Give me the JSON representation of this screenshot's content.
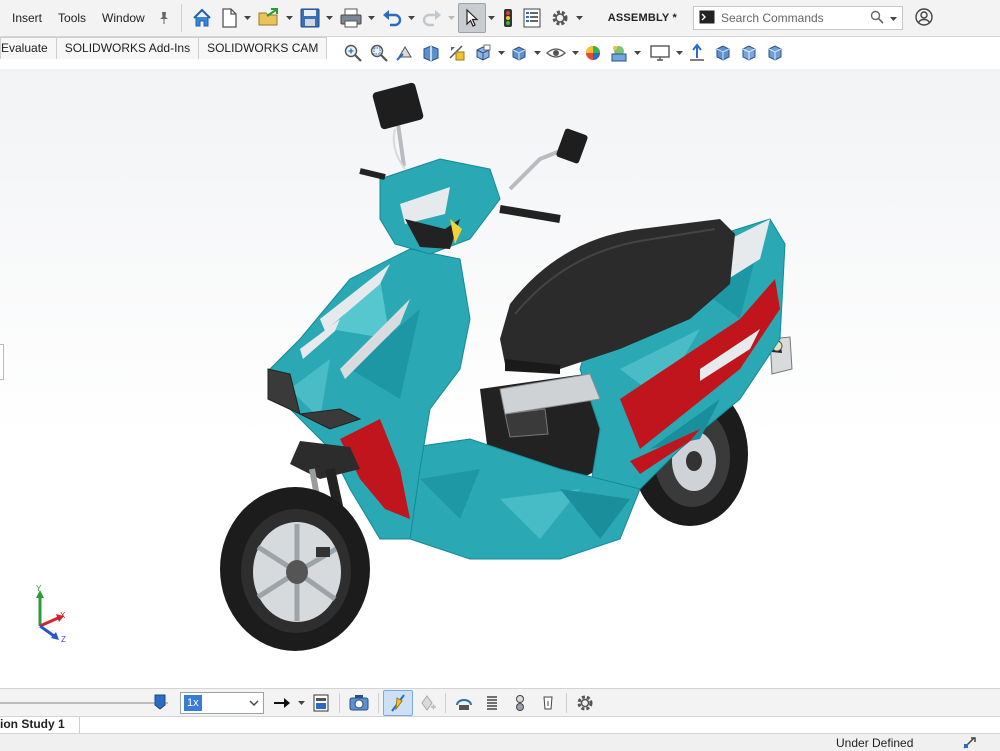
{
  "menu": {
    "items": [
      "Insert",
      "Tools",
      "Window"
    ]
  },
  "toolbar": {
    "document_title": "ASSEMBLY *",
    "search_placeholder": "Search Commands"
  },
  "command_tabs": [
    "Evaluate",
    "SOLIDWORKS Add-Ins",
    "SOLIDWORKS CAM"
  ],
  "motion": {
    "speed": "1x",
    "timeline_position": 0.95
  },
  "study_tab": "ion Study 1",
  "status": {
    "text": "Under Defined"
  },
  "triad": {
    "x": "X",
    "y": "Y",
    "z": "Z"
  },
  "colors": {
    "body": "#2aa8b4",
    "accent": "#c0151c",
    "seat": "#2b2b2b",
    "axis_x": "#d6232a",
    "axis_y": "#2e9a3a",
    "axis_z": "#2b55c8"
  }
}
